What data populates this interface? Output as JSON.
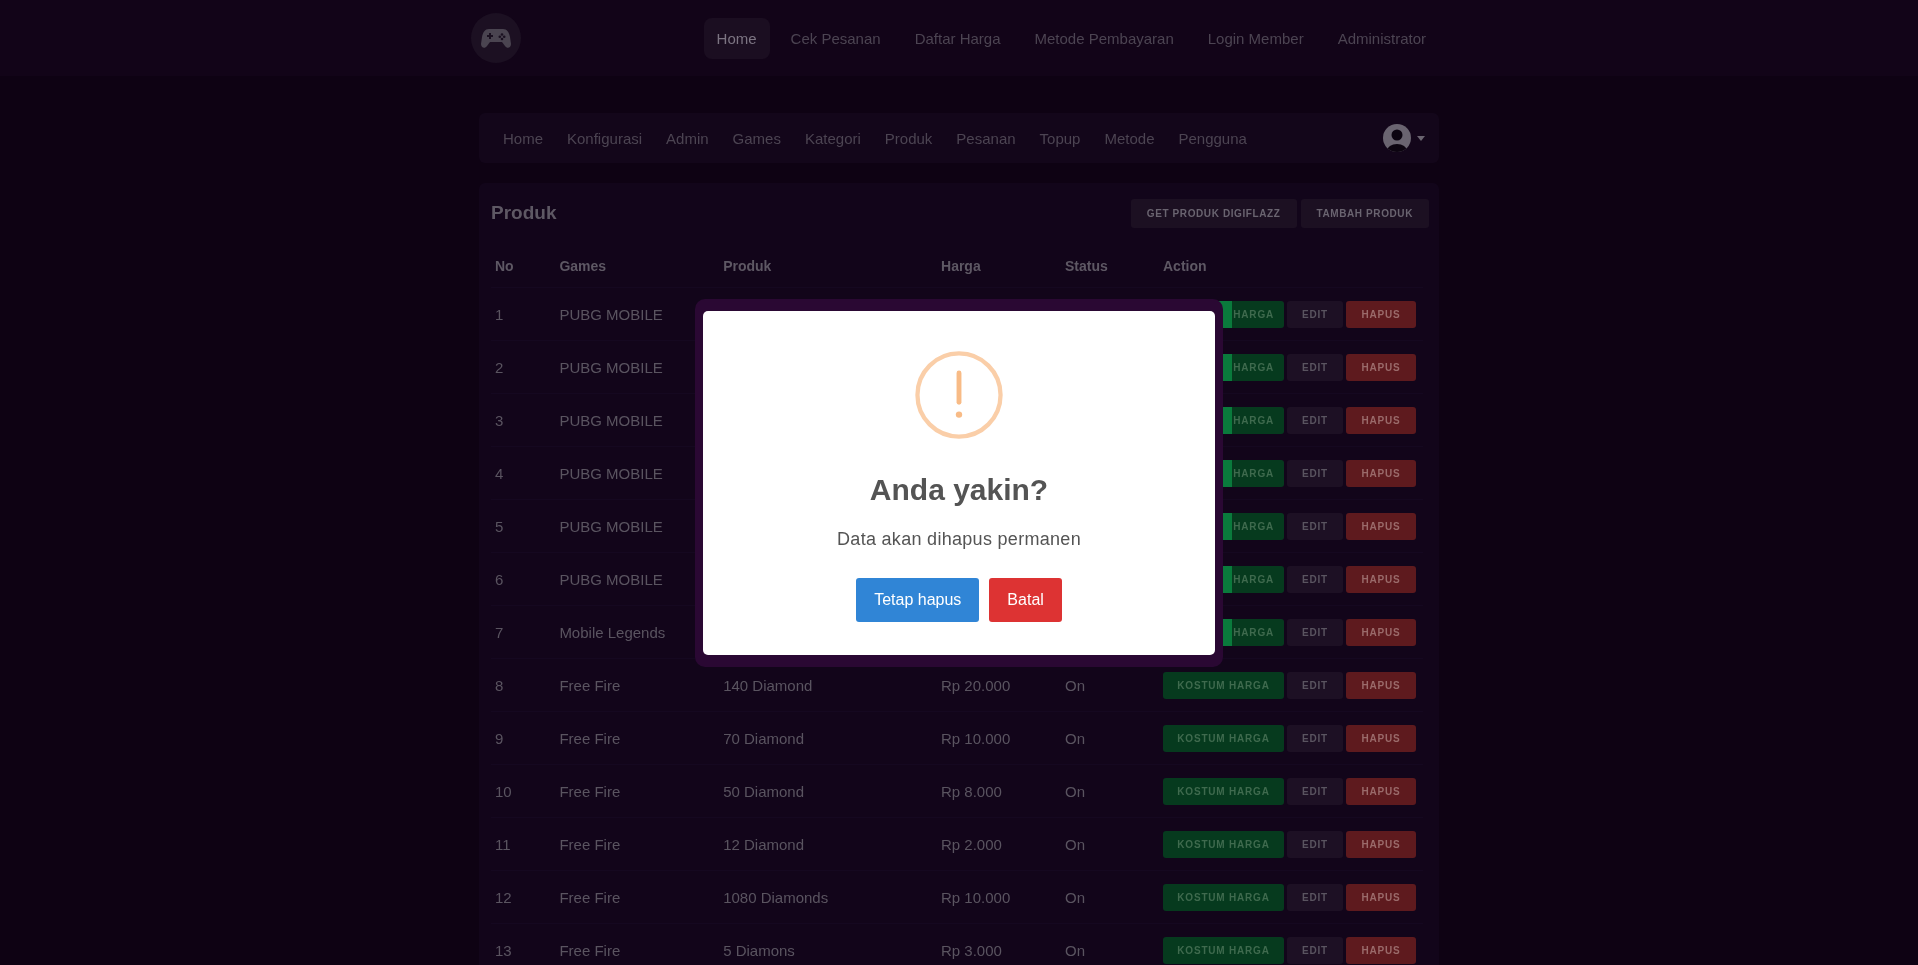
{
  "top_nav": {
    "items": [
      {
        "label": "Home",
        "selected": true
      },
      {
        "label": "Cek Pesanan",
        "selected": false
      },
      {
        "label": "Daftar Harga",
        "selected": false
      },
      {
        "label": "Metode Pembayaran",
        "selected": false
      },
      {
        "label": "Login Member",
        "selected": false
      },
      {
        "label": "Administrator",
        "selected": false
      }
    ]
  },
  "admin_nav": {
    "items": [
      "Home",
      "Konfigurasi",
      "Admin",
      "Games",
      "Kategori",
      "Produk",
      "Pesanan",
      "Topup",
      "Metode",
      "Pengguna"
    ]
  },
  "products": {
    "title": "Produk",
    "buttons": [
      "GET PRODUK DIGIFLAZZ",
      "TAMBAH PRODUK"
    ],
    "columns": [
      "No",
      "Games",
      "Produk",
      "Harga",
      "Status",
      "Action"
    ],
    "rows": [
      {
        "kind": "covered",
        "no": "1",
        "game": "PUBG MOBILE",
        "actions": [
          "HARGA",
          "EDIT",
          "HAPUS"
        ]
      },
      {
        "kind": "covered",
        "no": "2",
        "game": "PUBG MOBILE",
        "actions": [
          "HARGA",
          "EDIT",
          "HAPUS"
        ]
      },
      {
        "kind": "covered",
        "no": "3",
        "game": "PUBG MOBILE",
        "actions": [
          "HARGA",
          "EDIT",
          "HAPUS"
        ]
      },
      {
        "kind": "covered",
        "no": "4",
        "game": "PUBG MOBILE",
        "actions": [
          "HARGA",
          "EDIT",
          "HAPUS"
        ]
      },
      {
        "kind": "covered",
        "no": "5",
        "game": "PUBG MOBILE",
        "actions": [
          "HARGA",
          "EDIT",
          "HAPUS"
        ]
      },
      {
        "kind": "covered",
        "no": "6",
        "game": "PUBG MOBILE",
        "actions": [
          "HARGA",
          "EDIT",
          "HAPUS"
        ]
      },
      {
        "kind": "covered",
        "no": "7",
        "game": "Mobile Legends",
        "actions": [
          "HARGA",
          "EDIT",
          "HAPUS"
        ]
      },
      {
        "kind": "full",
        "no": "8",
        "game": "Free Fire",
        "product": "140 Diamond",
        "price": "Rp 20.000",
        "status": "On",
        "actions": [
          "KOSTUM HARGA",
          "EDIT",
          "HAPUS"
        ]
      },
      {
        "kind": "full",
        "no": "9",
        "game": "Free Fire",
        "product": "70 Diamond",
        "price": "Rp 10.000",
        "status": "On",
        "actions": [
          "KOSTUM HARGA",
          "EDIT",
          "HAPUS"
        ]
      },
      {
        "kind": "full",
        "no": "10",
        "game": "Free Fire",
        "product": "50 Diamond",
        "price": "Rp 8.000",
        "status": "On",
        "actions": [
          "KOSTUM HARGA",
          "EDIT",
          "HAPUS"
        ]
      },
      {
        "kind": "full",
        "no": "11",
        "game": "Free Fire",
        "product": "12 Diamond",
        "price": "Rp 2.000",
        "status": "On",
        "actions": [
          "KOSTUM HARGA",
          "EDIT",
          "HAPUS"
        ]
      },
      {
        "kind": "full",
        "no": "12",
        "game": "Free Fire",
        "product": "1080 Diamonds",
        "price": "Rp 10.000",
        "status": "On",
        "actions": [
          "KOSTUM HARGA",
          "EDIT",
          "HAPUS"
        ]
      },
      {
        "kind": "full",
        "no": "13",
        "game": "Free Fire",
        "product": "5 Diamons",
        "price": "Rp 3.000",
        "status": "On",
        "actions": [
          "KOSTUM HARGA",
          "EDIT",
          "HAPUS"
        ]
      }
    ]
  },
  "dialog": {
    "title": "Anda yakin?",
    "text": "Data akan dihapus permanen",
    "buttons": [
      {
        "label": "Tetap hapus",
        "kind": "confirm"
      },
      {
        "label": "Batal",
        "kind": "cancel"
      }
    ]
  }
}
